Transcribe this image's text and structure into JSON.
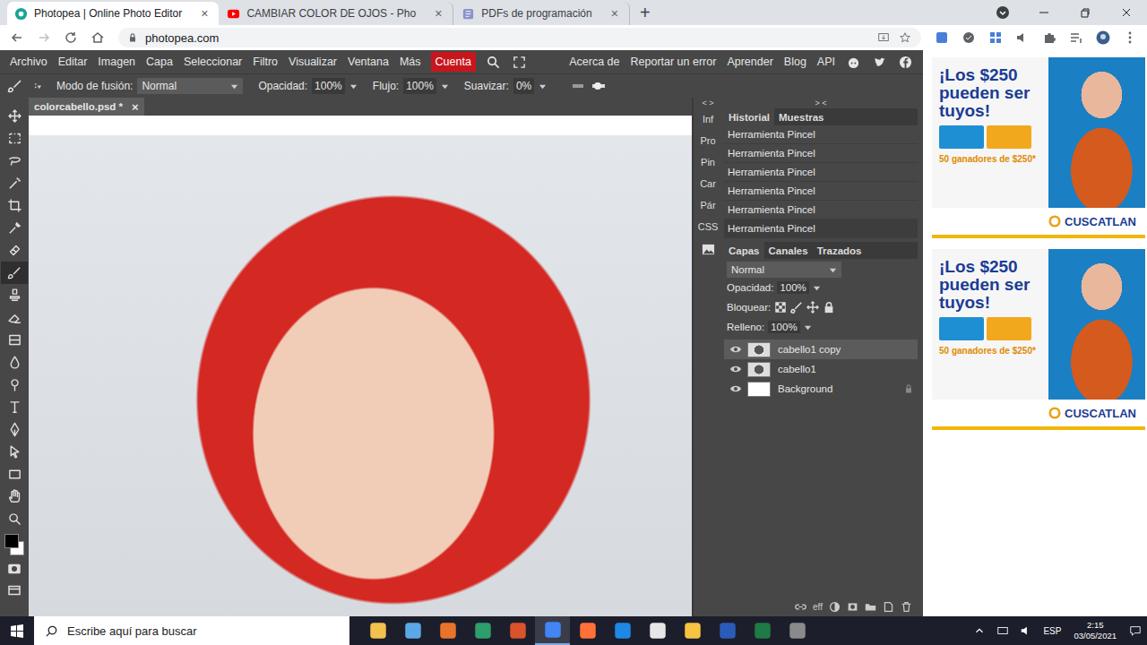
{
  "browser": {
    "tabs": [
      {
        "label": "Photopea | Online Photo Editor",
        "selected": true,
        "close": "×",
        "kind": "photopea"
      },
      {
        "label": "CAMBIAR COLOR DE OJOS - Pho",
        "selected": false,
        "close": "×",
        "kind": "youtube"
      },
      {
        "label": "PDFs de programación",
        "selected": false,
        "close": "×",
        "kind": "doc"
      }
    ],
    "new_tab": "+",
    "url": "photopea.com"
  },
  "menu": {
    "items": [
      "Archivo",
      "Editar",
      "Imagen",
      "Capa",
      "Seleccionar",
      "Filtro",
      "Visualizar",
      "Ventana",
      "Más"
    ],
    "account": "Cuenta",
    "right": [
      "Acerca de",
      "Reportar un error",
      "Aprender",
      "Blog",
      "API"
    ]
  },
  "options": {
    "blend_label": "Modo de fusión:",
    "blend_value": "Normal",
    "opacity_label": "Opacidad:",
    "opacity_value": "100%",
    "flow_label": "Flujo:",
    "flow_value": "100%",
    "smooth_label": "Suavizar:",
    "smooth_value": "0%"
  },
  "tools": [
    {
      "selected": false
    },
    {
      "selected": false
    },
    {
      "selected": false
    },
    {
      "selected": false
    },
    {
      "selected": false
    },
    {
      "selected": false
    },
    {
      "selected": false
    },
    {
      "selected": true
    },
    {
      "selected": false
    },
    {
      "selected": false
    },
    {
      "selected": false
    },
    {
      "selected": false
    },
    {
      "selected": false
    },
    {
      "selected": false
    },
    {
      "selected": false
    },
    {
      "selected": false
    },
    {
      "selected": false
    },
    {
      "selected": false
    },
    {
      "selected": false
    }
  ],
  "document": {
    "tab": "colorcabello.psd *",
    "close": "×"
  },
  "side_panel": {
    "toggle": "< >",
    "tabs": [
      "Inf",
      "Pro",
      "Pin",
      "Car",
      "Pár",
      "CSS"
    ]
  },
  "history": {
    "toggle": "> <",
    "tabs": [
      {
        "label": "Historial",
        "selected": true
      },
      {
        "label": "Muestras",
        "selected": false
      }
    ],
    "rows": [
      {
        "label": "Herramienta Pincel",
        "selected": false
      },
      {
        "label": "Herramienta Pincel",
        "selected": false
      },
      {
        "label": "Herramienta Pincel",
        "selected": false
      },
      {
        "label": "Herramienta Pincel",
        "selected": false
      },
      {
        "label": "Herramienta Pincel",
        "selected": false
      },
      {
        "label": "Herramienta Pincel",
        "selected": true
      }
    ]
  },
  "layers_panel": {
    "tabs": [
      {
        "label": "Capas",
        "selected": true
      },
      {
        "label": "Canales",
        "selected": false
      },
      {
        "label": "Trazados",
        "selected": false
      }
    ],
    "blend": "Normal",
    "opacity_label": "Opacidad:",
    "opacity_value": "100%",
    "lock_label": "Bloquear:",
    "fill_label": "Relleno:",
    "fill_value": "100%",
    "layers": [
      {
        "name": "cabello1 copy",
        "visible": true,
        "selected": true,
        "locked": false,
        "kind": "image"
      },
      {
        "name": "cabello1",
        "visible": true,
        "selected": false,
        "locked": false,
        "kind": "image"
      },
      {
        "name": "Background",
        "visible": true,
        "selected": false,
        "locked": true,
        "kind": "fill"
      }
    ],
    "effects_label": "eff"
  },
  "ads": [
    {
      "headline": "¡Los $250 pueden ser tuyos!",
      "prize": "50 ganadores de $250*",
      "brand": "CUSCATLAN"
    },
    {
      "headline": "¡Los $250 pueden ser tuyos!",
      "prize": "50 ganadores de $250*",
      "brand": "CUSCATLAN"
    }
  ],
  "taskbar": {
    "search": "Escribe aquí para buscar",
    "lang": "ESP",
    "time": "2:15",
    "date": "03/05/2021"
  }
}
